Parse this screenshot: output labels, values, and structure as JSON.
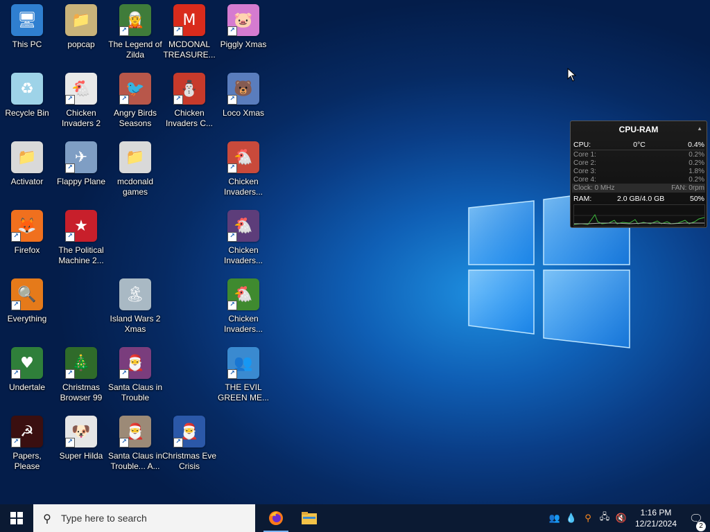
{
  "desktop": {
    "icons": [
      {
        "label": "This PC",
        "glyph": "🖥",
        "bg": "#2f7fd0",
        "shortcut": false
      },
      {
        "label": "popcap",
        "glyph": "📁",
        "bg": "#c9b37a",
        "shortcut": false
      },
      {
        "label": "The Legend of Zilda",
        "glyph": "🧝",
        "bg": "#3f7c3a",
        "shortcut": true
      },
      {
        "label": "MCDONAL TREASURE...",
        "glyph": "M",
        "bg": "#d92b1c",
        "shortcut": true
      },
      {
        "label": "Piggly Xmas",
        "glyph": "🐷",
        "bg": "#d57bd0",
        "shortcut": true
      },
      {
        "label": "Recycle Bin",
        "glyph": "♻",
        "bg": "#9ed3e8",
        "shortcut": false
      },
      {
        "label": "Chicken Invaders 2",
        "glyph": "🐔",
        "bg": "#e9e9e9",
        "shortcut": true
      },
      {
        "label": "Angry Birds Seasons",
        "glyph": "🐦",
        "bg": "#b8574a",
        "shortcut": true
      },
      {
        "label": "Chicken Invaders C...",
        "glyph": "⛄",
        "bg": "#c73a2b",
        "shortcut": true
      },
      {
        "label": "Loco Xmas",
        "glyph": "🐻",
        "bg": "#5a7dbd",
        "shortcut": true
      },
      {
        "label": "Activator",
        "glyph": "📁",
        "bg": "#d9d9d9",
        "shortcut": false
      },
      {
        "label": "Flappy Plane",
        "glyph": "✈",
        "bg": "#7f9ec4",
        "shortcut": true
      },
      {
        "label": "mcdonald games",
        "glyph": "📁",
        "bg": "#d9d9d9",
        "shortcut": false
      },
      {
        "label": "Chicken Invaders...",
        "glyph": "🐔",
        "bg": "#c94a3b",
        "shortcut": true
      },
      {
        "label": "Firefox",
        "glyph": "🦊",
        "bg": "#f0701e",
        "shortcut": true
      },
      {
        "label": "The Political Machine 2...",
        "glyph": "★",
        "bg": "#c81f2b",
        "shortcut": true
      },
      {
        "label": "Chicken Invaders...",
        "glyph": "🐔",
        "bg": "#5d3d7a",
        "shortcut": true
      },
      {
        "label": "Everything",
        "glyph": "🔍",
        "bg": "#e57a1a",
        "shortcut": true
      },
      {
        "label": "Island Wars 2 Xmas",
        "glyph": "🏝",
        "bg": "#a9b9c4",
        "shortcut": false
      },
      {
        "label": "Chicken Invaders...",
        "glyph": "🐔",
        "bg": "#3f8a2f",
        "shortcut": true
      },
      {
        "label": "Undertale",
        "glyph": "♥",
        "bg": "#2f7f3a",
        "shortcut": true
      },
      {
        "label": "Christmas Browser 99",
        "glyph": "🎄",
        "bg": "#2f6b2a",
        "shortcut": true
      },
      {
        "label": "Santa Claus in Trouble",
        "glyph": "🎅",
        "bg": "#7a3d7d",
        "shortcut": true
      },
      {
        "label": "THE EVIL GREEN ME...",
        "glyph": "👥",
        "bg": "#3a8ad0",
        "shortcut": true
      },
      {
        "label": "Papers, Please",
        "glyph": "☭",
        "bg": "#3a0f10",
        "shortcut": true
      },
      {
        "label": "Super Hilda",
        "glyph": "🐶",
        "bg": "#e6e6e6",
        "shortcut": true
      },
      {
        "label": "Santa Claus in Trouble... A...",
        "glyph": "🎅",
        "bg": "#9c8a77",
        "shortcut": true
      },
      {
        "label": "Christmas Eve Crisis",
        "glyph": "🎅",
        "bg": "#2b58a8",
        "shortcut": true
      }
    ]
  },
  "gadget": {
    "title": "CPU-RAM",
    "cpu_label": "CPU:",
    "cpu_temp": "0°C",
    "cpu_pct": "0.4%",
    "cores": [
      {
        "label": "Core 1:",
        "value": "0.2%"
      },
      {
        "label": "Core 2:",
        "value": "0.2%"
      },
      {
        "label": "Core 3:",
        "value": "1.8%"
      },
      {
        "label": "Core 4:",
        "value": "0.2%"
      }
    ],
    "clock": "Clock: 0 MHz",
    "fan": "FAN: 0rpm",
    "ram_label": "RAM:",
    "ram_usage": "2.0 GB/4.0 GB",
    "ram_pct": "50%"
  },
  "taskbar": {
    "search_placeholder": "Type here to search",
    "time": "1:16 PM",
    "date": "12/21/2024",
    "notification_count": "2"
  }
}
